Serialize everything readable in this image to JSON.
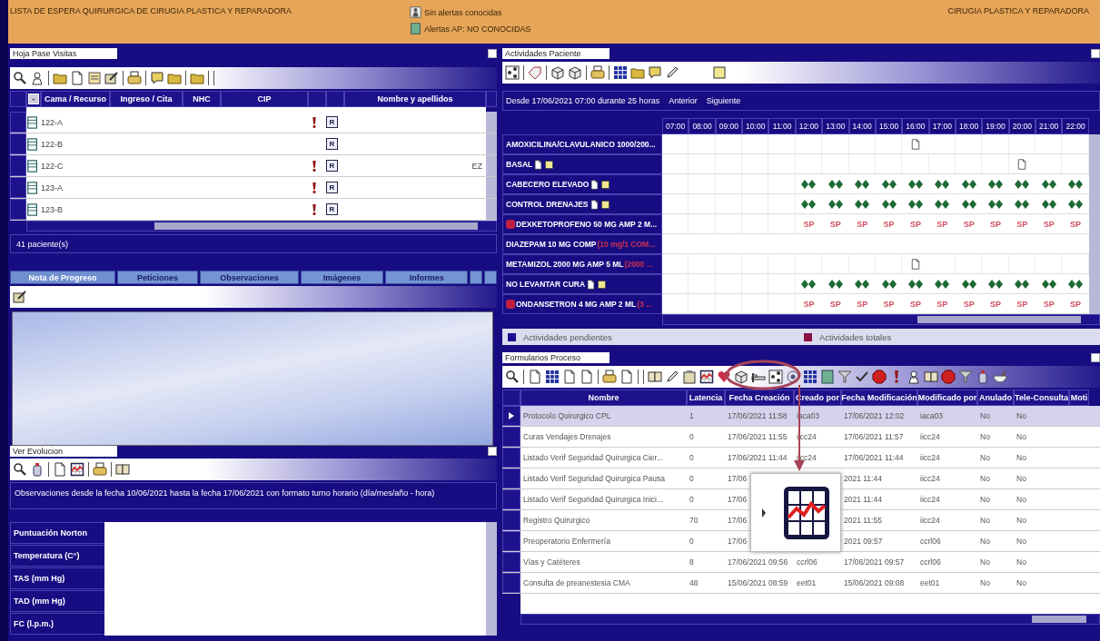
{
  "header": {
    "title": "LISTA DE ESPERA QUIRURGICA DE CIRUGIA PLASTICA Y REPARADORA",
    "alerts": [
      "Sin alertas conocidas",
      "Alertas AP: NO CONOCIDAS"
    ],
    "service": "CIRUGIA PLASTICA Y REPARADORA"
  },
  "visits": {
    "title": "Hoja Pase Visitas",
    "checked": false,
    "collapse": "-",
    "columns": [
      "Cama / Recurso",
      "Ingreso / Cita",
      "NHC",
      "CIP",
      "Nombre y apellidos"
    ],
    "rows": [
      {
        "bed": "122-A",
        "alert": true,
        "tag": "R"
      },
      {
        "bed": "122-B",
        "alert": false,
        "tag": "R"
      },
      {
        "bed": "122-C",
        "alert": true,
        "tag": "R",
        "name": "EZ"
      },
      {
        "bed": "123-A",
        "alert": true,
        "tag": "R"
      },
      {
        "bed": "123-B",
        "alert": true,
        "tag": "R"
      }
    ],
    "footer": "41 paciente(s)"
  },
  "tabs": [
    {
      "label": "Nota de Progreso",
      "selected": true
    },
    {
      "label": "Peticiones",
      "selected": false
    },
    {
      "label": "Observaciones",
      "selected": false
    },
    {
      "label": "Imágenes",
      "selected": false
    },
    {
      "label": "Informes",
      "selected": false
    }
  ],
  "evolution": {
    "title": "Ver Evolucion",
    "checked": false,
    "range": "Observaciones desde la fecha 10/06/2021 hasta la fecha 17/06/2021 con formato turno horario (día/mes/año - hora)",
    "vitals": [
      "Puntuación Norton",
      "Temperatura (C°)",
      "TAS (mm Hg)",
      "TAD (mm Hg)",
      "FC (l.p.m.)"
    ]
  },
  "activities": {
    "title": "Actividades Paciente",
    "checked": false,
    "range": "Desde 17/06/2021 07:00 durante 25 horas",
    "prev": "Anterior",
    "next": "Siguiente",
    "hours": [
      "07:00",
      "08:00",
      "09:00",
      "10:00",
      "11:00",
      "12:00",
      "13:00",
      "14:00",
      "15:00",
      "16:00",
      "17:00",
      "18:00",
      "19:00",
      "20:00",
      "21:00",
      "22:00"
    ],
    "rows": [
      {
        "label": "AMOXICILINA/CLAVULANICO 1000/200...",
        "kind": "drug",
        "marks": {
          "kind": "doc",
          "slots": [
            false,
            false,
            false,
            false,
            false,
            false,
            false,
            false,
            false,
            true,
            false,
            false,
            false,
            false,
            false,
            false
          ]
        }
      },
      {
        "label": "BASAL",
        "kind": "care",
        "marks": {
          "kind": "doc",
          "slots": [
            false,
            false,
            false,
            false,
            false,
            false,
            false,
            false,
            false,
            false,
            false,
            false,
            false,
            true,
            false,
            false
          ]
        }
      },
      {
        "label": "CABECERO ELEVADO",
        "kind": "care",
        "marks": {
          "kind": "diamond",
          "slots": [
            false,
            false,
            false,
            false,
            false,
            true,
            true,
            true,
            true,
            true,
            true,
            true,
            true,
            true,
            true,
            true
          ]
        }
      },
      {
        "label": "CONTROL DRENAJES",
        "kind": "care",
        "marks": {
          "kind": "diamond",
          "slots": [
            false,
            false,
            false,
            false,
            false,
            true,
            true,
            true,
            true,
            true,
            true,
            true,
            true,
            true,
            true,
            true
          ]
        }
      },
      {
        "label": "DEXKETOPROFENO 50 MG AMP 2 M...",
        "kind": "flagged",
        "marks": {
          "kind": "code",
          "slots": [
            false,
            false,
            false,
            false,
            false,
            true,
            true,
            true,
            true,
            true,
            true,
            true,
            true,
            true,
            true,
            true
          ],
          "labels": [
            "SP",
            "SP",
            "SP",
            "SP",
            "SP",
            "SP",
            "SP",
            "SP",
            "SP",
            "SP",
            "SP"
          ]
        }
      },
      {
        "label": "DIAZEPAM 10 MG COMP",
        "kind": "drug",
        "note": "(10 mg/1 COM..."
      },
      {
        "label": "METAMIZOL 2000 MG AMP 5 ML",
        "kind": "drug",
        "note": "(2000 ...",
        "marks": {
          "kind": "doc",
          "slots": [
            false,
            false,
            false,
            false,
            false,
            false,
            false,
            false,
            false,
            true,
            false,
            false,
            false,
            false,
            false,
            false
          ]
        }
      },
      {
        "label": "NO LEVANTAR CURA",
        "kind": "care",
        "marks": {
          "kind": "diamond",
          "slots": [
            false,
            false,
            false,
            false,
            false,
            true,
            true,
            true,
            true,
            true,
            true,
            true,
            true,
            true,
            true,
            true
          ]
        }
      },
      {
        "label": "ONDANSETRON 4 MG AMP 2 ML",
        "kind": "flagged",
        "note": "(3 ...",
        "marks": {
          "kind": "code",
          "slots": [
            false,
            false,
            false,
            false,
            false,
            true,
            true,
            true,
            true,
            true,
            true,
            true,
            true,
            true,
            true,
            true
          ],
          "labels": [
            "SP",
            "SP",
            "SP",
            "SP",
            "SP",
            "SP",
            "SP",
            "SP",
            "SP",
            "SP",
            "SP"
          ]
        }
      }
    ],
    "legend": [
      {
        "label": "Actividades pendientes",
        "color": "#1a1090"
      },
      {
        "label": "Actividades totales",
        "color": "#8a1040"
      }
    ]
  },
  "forms": {
    "title": "Formularios Proceso",
    "checked": false,
    "columns": [
      "Nombre",
      "Latencia",
      "Fecha Creación",
      "Creado por",
      "Fecha Modificación",
      "Modificado por",
      "Anulado",
      "Tele-Consulta",
      "Moti"
    ],
    "rows": [
      {
        "selected": true,
        "nombre": "Protocolo Quirurgico CPL",
        "latencia": "1",
        "fecha_creacion": "17/06/2021 11:58",
        "creado_por": "iaca03",
        "fecha_modificacion": "17/06/2021 12:02",
        "modificado_por": "iaca03",
        "anulado": "No",
        "tele_consulta": "No"
      },
      {
        "selected": false,
        "nombre": "Curas Vendajes Drenajes",
        "latencia": "0",
        "fecha_creacion": "17/06/2021 11:55",
        "creado_por": "iicc24",
        "fecha_modificacion": "17/06/2021 11:57",
        "modificado_por": "iicc24",
        "anulado": "No",
        "tele_consulta": "No"
      },
      {
        "selected": false,
        "nombre": "Listado Verif Seguridad Quirurgica Cier...",
        "latencia": "0",
        "fecha_creacion": "17/06/2021 11:44",
        "creado_por": "iicc24",
        "fecha_modificacion": "17/06/2021 11:44",
        "modificado_por": "iicc24",
        "anulado": "No",
        "tele_consulta": "No"
      },
      {
        "selected": false,
        "nombre": "Listado Verif Seguridad Quirurgica Pausa",
        "latencia": "0",
        "fecha_creacion": "17/06",
        "fecha_modificacion": "2021 11:44",
        "modificado_por": "iicc24",
        "anulado": "No",
        "tele_consulta": "No"
      },
      {
        "selected": false,
        "nombre": "Listado Verif Seguridad Quirurgica Inici...",
        "latencia": "0",
        "fecha_creacion": "17/06",
        "fecha_modificacion": "2021 11:44",
        "modificado_por": "iicc24",
        "anulado": "No",
        "tele_consulta": "No"
      },
      {
        "selected": false,
        "nombre": "Registro Quirurgico",
        "latencia": "70",
        "fecha_creacion": "17/06",
        "fecha_modificacion": "2021 11:55",
        "modificado_por": "iicc24",
        "anulado": "No",
        "tele_consulta": "No"
      },
      {
        "selected": false,
        "nombre": "Preoperatorio Enfermería",
        "latencia": "0",
        "fecha_creacion": "17/06",
        "fecha_modificacion": "2021 09:57",
        "modificado_por": "ccrl06",
        "anulado": "No",
        "tele_consulta": "No"
      },
      {
        "selected": false,
        "nombre": "Vías y Catéteres",
        "latencia": "8",
        "fecha_creacion": "17/06/2021 09:56",
        "creado_por": "ccrl06",
        "fecha_modificacion": "17/06/2021 09:57",
        "modificado_por": "ccrl06",
        "anulado": "No",
        "tele_consulta": "No"
      },
      {
        "selected": false,
        "nombre": "Consulta de preanestesia CMA",
        "latencia": "48",
        "fecha_creacion": "15/06/2021 08:59",
        "creado_por": "eet01",
        "fecha_modificacion": "15/06/2021 09:08",
        "modificado_por": "eet01",
        "anulado": "No",
        "tele_consulta": "No"
      }
    ]
  }
}
